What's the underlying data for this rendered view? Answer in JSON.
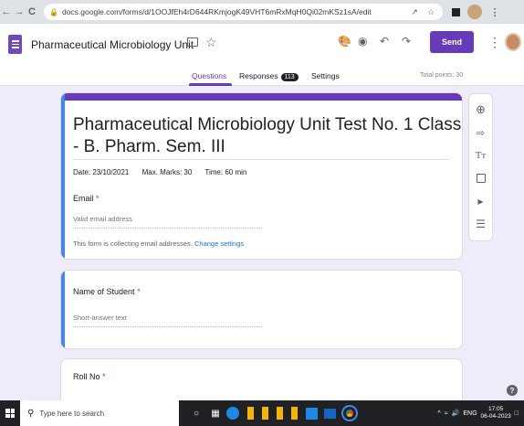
{
  "browser": {
    "url": "docs.google.com/forms/d/1OOJfEh4rD644RKmjogK49VHT6mRxMqH0Qi02mKSz1sA/edit",
    "nav_icons": [
      "back-arrow",
      "forward-arrow",
      "reload"
    ]
  },
  "header": {
    "title": "Pharmaceutical Microbiology Unit ",
    "send_label": "Send",
    "accent_color": "#673ab7"
  },
  "tabs": {
    "questions": "Questions",
    "responses": "Responses",
    "responses_count": "113",
    "settings": "Settings",
    "total_points": "Total points: 30"
  },
  "form": {
    "title_line1": "Pharmaceutical Microbiology Unit Test No. 1 Class",
    "title_line2": "- B. Pharm. Sem. III",
    "date": "Date: 23/10/2021",
    "max_marks": "Max. Marks: 30",
    "time": "Time: 60 min",
    "email_label": "Email",
    "required_mark": "*",
    "email_placeholder": "Valid email address",
    "collecting_note": "This form is collecting email addresses.",
    "change_settings": "Change settings"
  },
  "questions": [
    {
      "label": "Name of Student",
      "placeholder": "Short-answer text"
    },
    {
      "label": "Roll No"
    }
  ],
  "toolbar_icons": [
    "add-question-icon",
    "import-questions-icon",
    "add-title-icon",
    "add-image-icon",
    "add-video-icon",
    "add-section-icon"
  ],
  "taskbar": {
    "search_placeholder": "Type here to search",
    "lang": "ENG",
    "time": "17:05",
    "date": "06-04-2023"
  }
}
